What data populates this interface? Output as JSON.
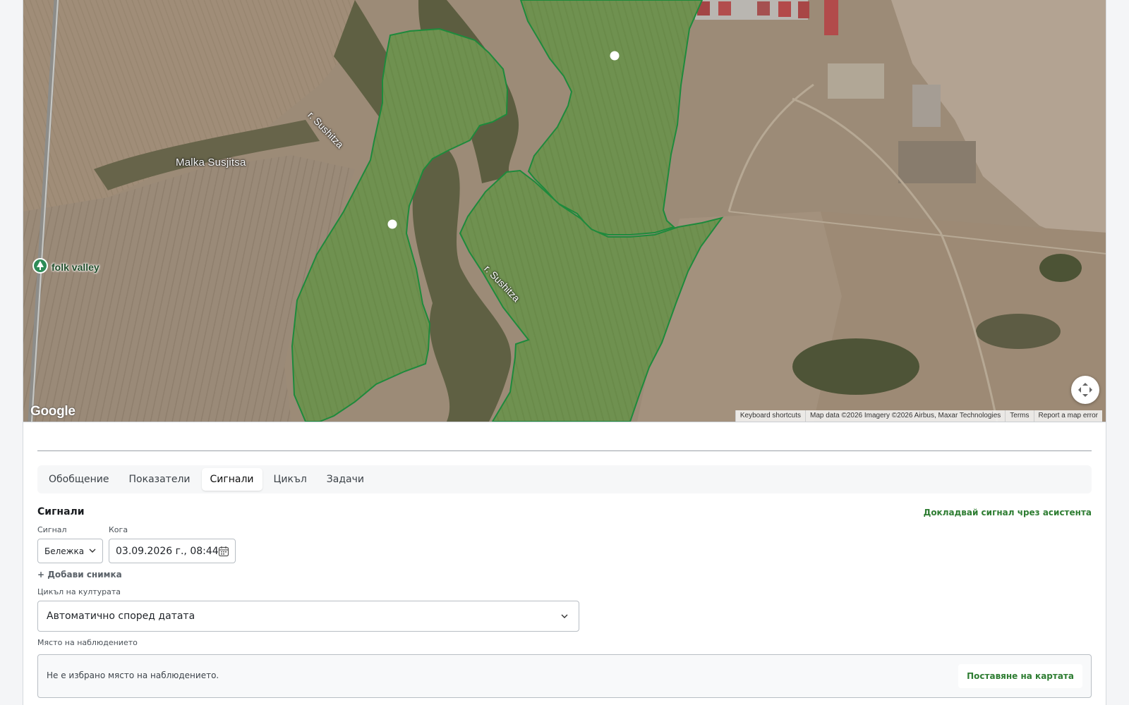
{
  "map": {
    "labels": {
      "village": "Malka Susjitsa",
      "river_1": "r. Sushitza",
      "river_2": "r. Sushitza",
      "poi": "folk valley"
    },
    "google_logo": "Google",
    "attribution": {
      "shortcuts": "Keyboard shortcuts",
      "data": "Map data ©2026 Imagery ©2026 Airbus, Maxar Technologies",
      "terms": "Terms",
      "report": "Report a map error"
    },
    "fullscreen_icon": "fullscreen-icon",
    "colors": {
      "field_outline": "#1e8a3c",
      "field_fill": "#4f8a3a"
    }
  },
  "tabs": [
    {
      "label": "Обобщение",
      "active": false
    },
    {
      "label": "Показатели",
      "active": false
    },
    {
      "label": "Сигнали",
      "active": true
    },
    {
      "label": "Цикъл",
      "active": false
    },
    {
      "label": "Задачи",
      "active": false
    }
  ],
  "signals": {
    "title": "Сигнали",
    "report_link": "Докладвай сигнал чрез асистента",
    "signal_label": "Сигнал",
    "signal_value": "Бележка",
    "when_label": "Кога",
    "when_value": "03.09.2026 г., 08:44",
    "add_photo": "+ Добави снимка",
    "cycle_label": "Цикъл на културата",
    "cycle_value": "Автоматично според датата",
    "place_label": "Място на наблюдението",
    "place_text": "Не е избрано място на наблюдението.",
    "place_button": "Поставяне на картата"
  },
  "accent": "#2e7d32"
}
